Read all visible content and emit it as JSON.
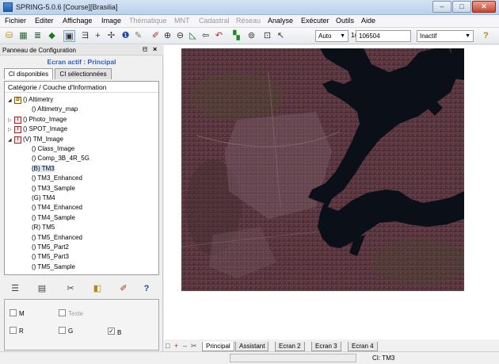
{
  "window": {
    "title": "SPRING-5.0.6 [Course][Brasilia]",
    "minimize_label": "–",
    "maximize_label": "□",
    "close_label": "✕"
  },
  "menu": [
    {
      "label": "Fichier",
      "enabled": true
    },
    {
      "label": "Editer",
      "enabled": true
    },
    {
      "label": "Affichage",
      "enabled": true
    },
    {
      "label": "Image",
      "enabled": true
    },
    {
      "label": "Thématique",
      "enabled": false
    },
    {
      "label": "MNT",
      "enabled": false
    },
    {
      "label": "Cadastral",
      "enabled": false
    },
    {
      "label": "Réseau",
      "enabled": false
    },
    {
      "label": "Analyse",
      "enabled": true
    },
    {
      "label": "Exécuter",
      "enabled": true
    },
    {
      "label": "Outils",
      "enabled": true
    },
    {
      "label": "Aide",
      "enabled": true
    }
  ],
  "toolbar": {
    "zoom_mode": "Auto",
    "scale_prefix": "1/",
    "scale_value": "106504",
    "status_mode": "Inactif",
    "icons": [
      "database-icon",
      "grid-icon",
      "layers-icon",
      "pencil-icon",
      "display-icon",
      "text-tool-icon",
      "plus-icon",
      "pan-icon",
      "info-icon",
      "paint-icon",
      "draw-icon",
      "zoom-in-icon",
      "zoom-out-icon",
      "zoom-area-icon",
      "previous-icon",
      "undo-icon",
      "color-icon",
      "zoom-dropdown-icon",
      "frame-icon",
      "cursor-icon",
      "help-icon"
    ]
  },
  "panel": {
    "title": "Panneau de Configuration",
    "pin_label": "ᗺ",
    "close_label": "×",
    "active_label": "Ecran actif : Principal",
    "tabs": [
      "CI disponibles",
      "CI sélectionnées"
    ],
    "tree_header": "Catégorie / Couche d'Information",
    "tree": [
      {
        "label": "() Altimetry",
        "level": 0,
        "expander": "◢",
        "icon": "D",
        "icon_type": "mnt",
        "selected": false
      },
      {
        "label": "() Altimetry_map",
        "level": 1,
        "expander": "",
        "icon": "",
        "icon_type": "",
        "selected": false
      },
      {
        "label": "() Photo_Image",
        "level": 0,
        "expander": "▷",
        "icon": "I",
        "icon_type": "img",
        "selected": false
      },
      {
        "label": "() SPOT_Image",
        "level": 0,
        "expander": "▷",
        "icon": "I",
        "icon_type": "img",
        "selected": false
      },
      {
        "label": "(V) TM_Image",
        "level": 0,
        "expander": "◢",
        "icon": "I",
        "icon_type": "img",
        "selected": false
      },
      {
        "label": "() Class_Image",
        "level": 1,
        "expander": "",
        "icon": "",
        "icon_type": "",
        "selected": false
      },
      {
        "label": "() Comp_3B_4R_5G",
        "level": 1,
        "expander": "",
        "icon": "",
        "icon_type": "",
        "selected": false
      },
      {
        "label": "(B) TM3",
        "level": 1,
        "expander": "",
        "icon": "",
        "icon_type": "",
        "selected": true
      },
      {
        "label": "() TM3_Enhanced",
        "level": 1,
        "expander": "",
        "icon": "",
        "icon_type": "",
        "selected": false
      },
      {
        "label": "() TM3_Sample",
        "level": 1,
        "expander": "",
        "icon": "",
        "icon_type": "",
        "selected": false
      },
      {
        "label": "(G) TM4",
        "level": 1,
        "expander": "",
        "icon": "",
        "icon_type": "",
        "selected": false
      },
      {
        "label": "() TM4_Enhanced",
        "level": 1,
        "expander": "",
        "icon": "",
        "icon_type": "",
        "selected": false
      },
      {
        "label": "() TM4_Sample",
        "level": 1,
        "expander": "",
        "icon": "",
        "icon_type": "",
        "selected": false
      },
      {
        "label": "(R) TM5",
        "level": 1,
        "expander": "",
        "icon": "",
        "icon_type": "",
        "selected": false
      },
      {
        "label": "() TM5_Enhanced",
        "level": 1,
        "expander": "",
        "icon": "",
        "icon_type": "",
        "selected": false
      },
      {
        "label": "() TM5_Part2",
        "level": 1,
        "expander": "",
        "icon": "",
        "icon_type": "",
        "selected": false
      },
      {
        "label": "() TM5_Part3",
        "level": 1,
        "expander": "",
        "icon": "",
        "icon_type": "",
        "selected": false
      },
      {
        "label": "() TM5_Sample",
        "level": 1,
        "expander": "",
        "icon": "",
        "icon_type": "",
        "selected": false
      }
    ],
    "actions": [
      "list-icon",
      "properties-icon",
      "tools-icon",
      "chart-icon",
      "edit-icon",
      "help-icon"
    ],
    "options": {
      "m_label": "M",
      "m_checked": false,
      "texte_label": "Texte",
      "texte_checked": false,
      "r_label": "R",
      "r_checked": false,
      "g_label": "G",
      "g_checked": false,
      "b_label": "B",
      "b_checked": true,
      "check_mark": "✓"
    }
  },
  "bottom_tabs": {
    "nav": [
      "□",
      "+",
      "–",
      "✂"
    ],
    "tabs": [
      "Principal",
      "Assistant",
      "Ecran 2",
      "Ecran 3",
      "Ecran 4"
    ],
    "active": "Principal"
  },
  "status": {
    "ci_label": "CI: TM3"
  },
  "colors": {
    "active_label": "#2a5cc9",
    "map_water": "#0a0f18",
    "map_land": "#5a3440",
    "map_urban": "#7a5a66"
  }
}
